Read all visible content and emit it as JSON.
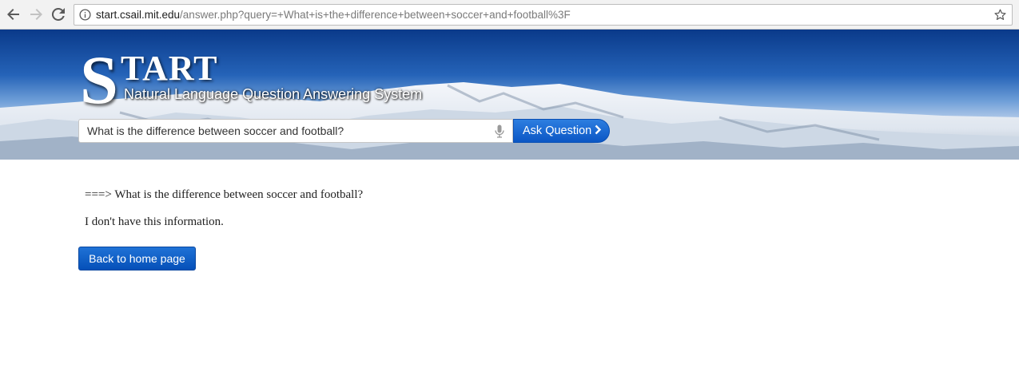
{
  "browser": {
    "url_host": "start.csail.mit.edu",
    "url_path": "/answer.php?query=+What+is+the+difference+between+soccer+and+football%3F",
    "icons": [
      "back-arrow-icon",
      "forward-arrow-icon",
      "reload-icon",
      "info-icon",
      "star-icon"
    ]
  },
  "header": {
    "logo_initial": "S",
    "logo_rest": "TART",
    "subtitle": "Natural Language Question Answering System"
  },
  "search": {
    "value": "What is the difference between soccer and football?",
    "mic_icon": "microphone-icon",
    "ask_label": "Ask Question",
    "ask_icon": "chevron-right-icon"
  },
  "answer": {
    "question_line": "===> What is the difference between soccer and football?",
    "response": "I don't have this information."
  },
  "back_button": {
    "label": "Back to home page"
  },
  "colors": {
    "button_blue": "#0b57c5",
    "banner_sky": "#1f5fb5"
  }
}
